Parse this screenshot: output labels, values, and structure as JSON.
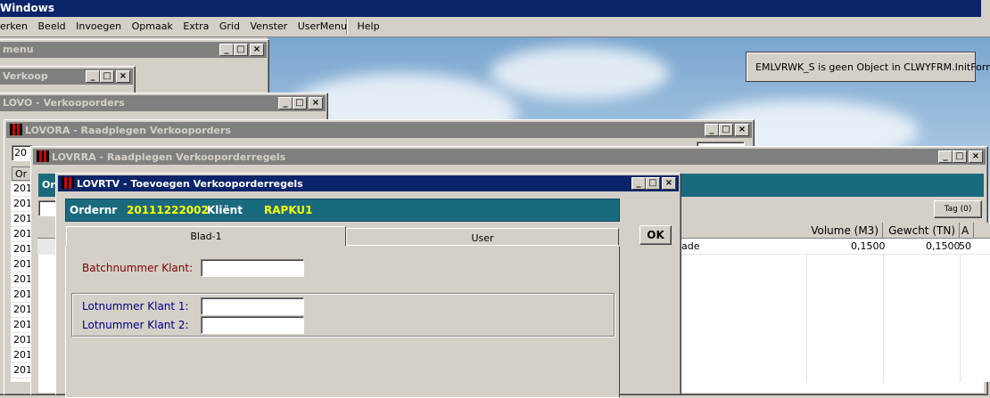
{
  "app": {
    "title": "Windows"
  },
  "menu": [
    "erken",
    "Beeld",
    "Invoegen",
    "Opmaak",
    "Extra",
    "Grid",
    "Venster",
    "UserMenu",
    "Help"
  ],
  "tooltip": "EMLVRWK_S is geen Object in CLWYFRM.InitForm.",
  "windows": {
    "menu": "menu",
    "verkoop": "Verkoop",
    "lovo": "LOVO - Verkooporders",
    "lovora": "LOVORA - Raadplegen Verkooporders",
    "lovrra": "LOVRRA - Raadplegen Verkooporderregels",
    "lovrtv": "LOVRTV - Toevoegen Verkooporderregels"
  },
  "lovora": {
    "field_value": "20",
    "col_header": "Or"
  },
  "grid_left": [
    "201",
    "201",
    "201",
    "201",
    "201",
    "201",
    "201",
    "201",
    "201",
    "201",
    "201",
    "201",
    "201"
  ],
  "lovrra": {
    "teal_label": "Or",
    "tag_button": "Tag (0)",
    "columns": [
      "Volume (M3)",
      "Gewcht (TN)",
      "A"
    ],
    "row": {
      "desc": "ade",
      "volume": "0,1500",
      "gewicht": "0,1500",
      "extra": "50"
    }
  },
  "lovrtv": {
    "ordernr_label": "Ordernr",
    "ordernr_value": "20111222002",
    "klient_label": "Kliënt",
    "klient_value": "RAPKU1",
    "tabs": [
      "Blad-1",
      "User"
    ],
    "ok_button": "OK",
    "batch_label": "Batchnummer Klant:",
    "lot1_label": "Lotnummer Klant 1:",
    "lot2_label": "Lotnummer Klant 2:",
    "batch_value": "",
    "lot1_value": "",
    "lot2_value": ""
  },
  "window_buttons": {
    "min": "_",
    "max": "□",
    "close": "×"
  },
  "colors": {
    "accent_yellow": "#ffff00",
    "label_red": "#800000",
    "label_blue": "#000080",
    "teal": "#1a6a7e",
    "title_active": "#0a246a"
  }
}
